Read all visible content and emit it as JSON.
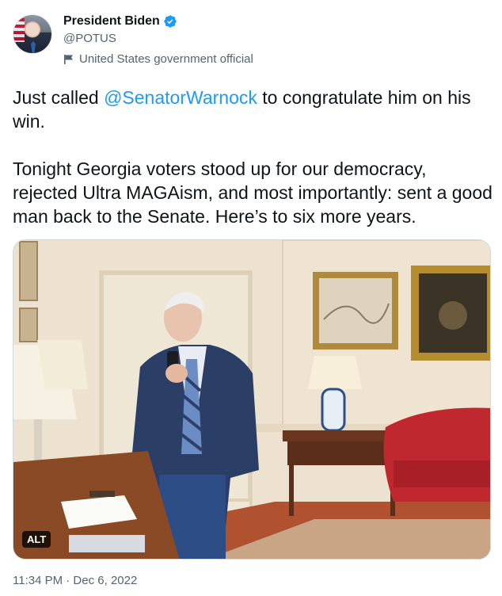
{
  "author": {
    "display_name": "President Biden",
    "handle": "@POTUS",
    "label": "United States government official"
  },
  "tweet": {
    "line1_pre": "Just called ",
    "mention": "@SenatorWarnock",
    "line1_post": " to congratulate him on his win.",
    "paragraph2": "Tonight Georgia voters stood up for our democracy, rejected Ultra MAGAism, and most importantly: sent a good man back to the Senate. Here’s to six more years."
  },
  "media": {
    "alt_badge": "ALT"
  },
  "meta": {
    "timestamp": "11:34 PM · Dec 6, 2022"
  },
  "colors": {
    "link": "#1d9bf0",
    "verified": "#1d9bf0",
    "secondary_text": "#536471"
  },
  "icons": {
    "verified": "verified-badge-icon",
    "label": "flag-icon"
  }
}
